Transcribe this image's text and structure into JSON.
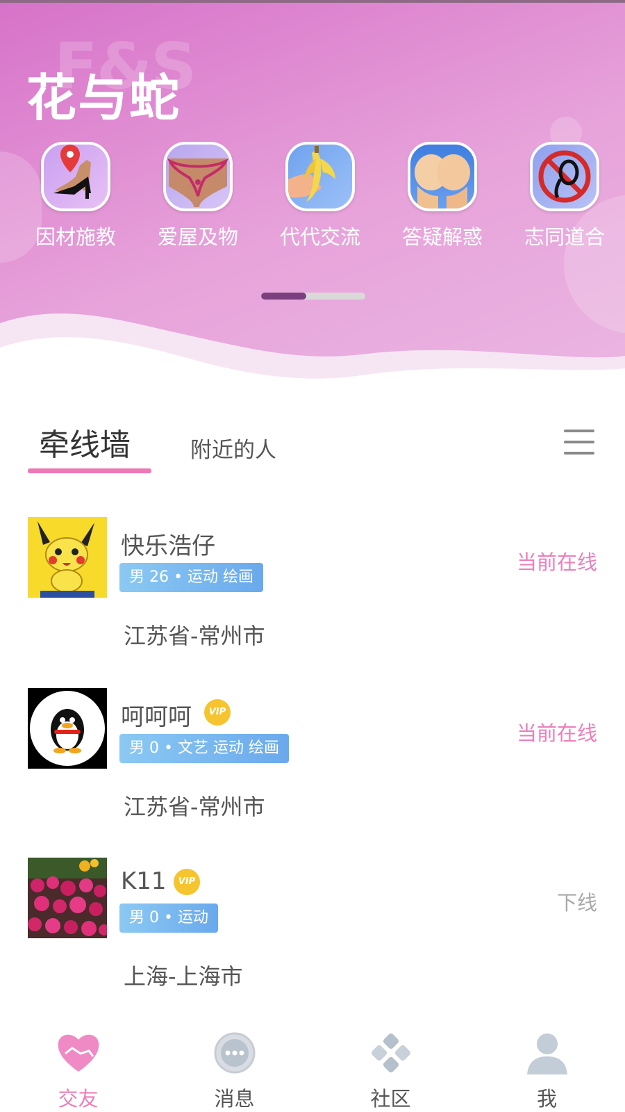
{
  "app": {
    "watermark": "F&S",
    "title": "花与蛇"
  },
  "categories": [
    {
      "label": "因材施教",
      "icon": "location-heel-icon"
    },
    {
      "label": "爱屋及物",
      "icon": "lingerie-icon"
    },
    {
      "label": "代代交流",
      "icon": "banana-icon"
    },
    {
      "label": "答疑解惑",
      "icon": "hands-icon"
    },
    {
      "label": "志同道合",
      "icon": "no-sign-icon"
    }
  ],
  "pager": {
    "progress": 0.43
  },
  "tabs": {
    "active": "牵线墙",
    "inactive": "附近的人"
  },
  "users": [
    {
      "name": "快乐浩仔",
      "vip": false,
      "tags": "男 26 • 运动 绘画",
      "location": "江苏省-常州市",
      "status": "当前在线",
      "status_color": "#ec7fb9",
      "avatar": "pikachu-avatar"
    },
    {
      "name": "呵呵呵",
      "vip": true,
      "vip_label": "VIP",
      "tags": "男 0 • 文艺 运动 绘画",
      "location": "江苏省-常州市",
      "status": "当前在线",
      "status_color": "#ec7fb9",
      "avatar": "penguin-avatar"
    },
    {
      "name": "K11",
      "vip": true,
      "vip_label": "VIP",
      "tags": "男 0 • 运动",
      "location": "上海-上海市",
      "status": "下线",
      "status_color": "#a9a9a9",
      "avatar": "flowers-avatar"
    }
  ],
  "nav": [
    {
      "label": "交友",
      "icon": "heart-handshake-icon",
      "active": true
    },
    {
      "label": "消息",
      "icon": "chat-bubble-icon",
      "active": false
    },
    {
      "label": "社区",
      "icon": "community-icon",
      "active": false
    },
    {
      "label": "我",
      "icon": "person-icon",
      "active": false
    }
  ],
  "colors": {
    "accent": "#ec7fb9",
    "header": "#d772c9",
    "tag": "#6aa9ec"
  }
}
